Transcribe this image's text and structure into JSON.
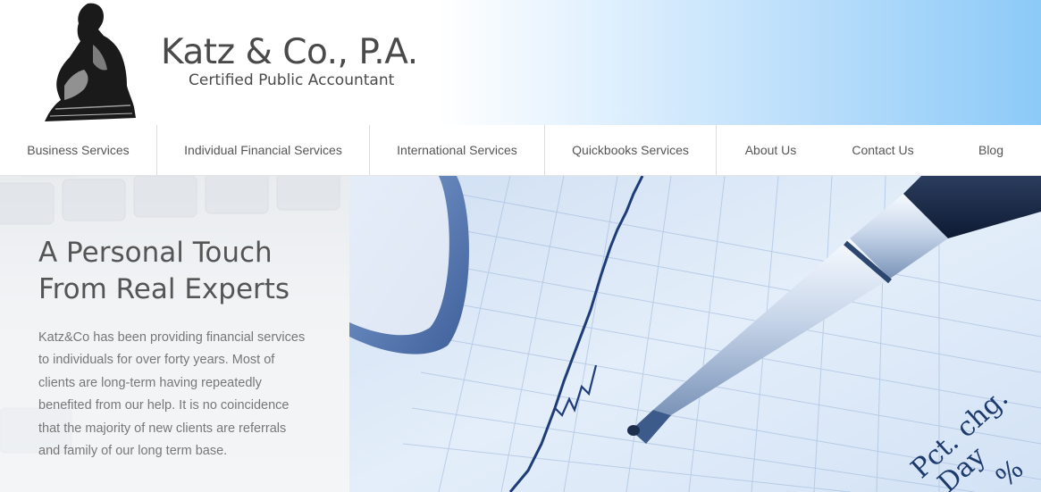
{
  "header": {
    "company_name": "Katz & Co., P.A.",
    "tagline": "Certified Public Accountant",
    "logo_icon": "thinker-statue-icon"
  },
  "nav": {
    "items": [
      {
        "label": "Business Services"
      },
      {
        "label": "Individual Financial Services"
      },
      {
        "label": "International Services"
      },
      {
        "label": "Quickbooks Services"
      },
      {
        "label": "About Us"
      },
      {
        "label": "Contact Us"
      },
      {
        "label": "Blog"
      }
    ]
  },
  "hero": {
    "title_line1": "A Personal Touch",
    "title_line2": "From Real Experts",
    "body": "Katz&Co has been providing financial services to individuals for over forty years. Most of clients are long-term having repeatedly benefited from our help. It is no coincidence that the majority of new clients are referrals and family of our long term base.",
    "image_text_1": "Pct. chg.",
    "image_text_2": "Day",
    "image_text_3": "%"
  },
  "colors": {
    "header_gradient_end": "#8ccaf8",
    "text_dark": "#4a4a4a",
    "nav_text": "#555555"
  }
}
